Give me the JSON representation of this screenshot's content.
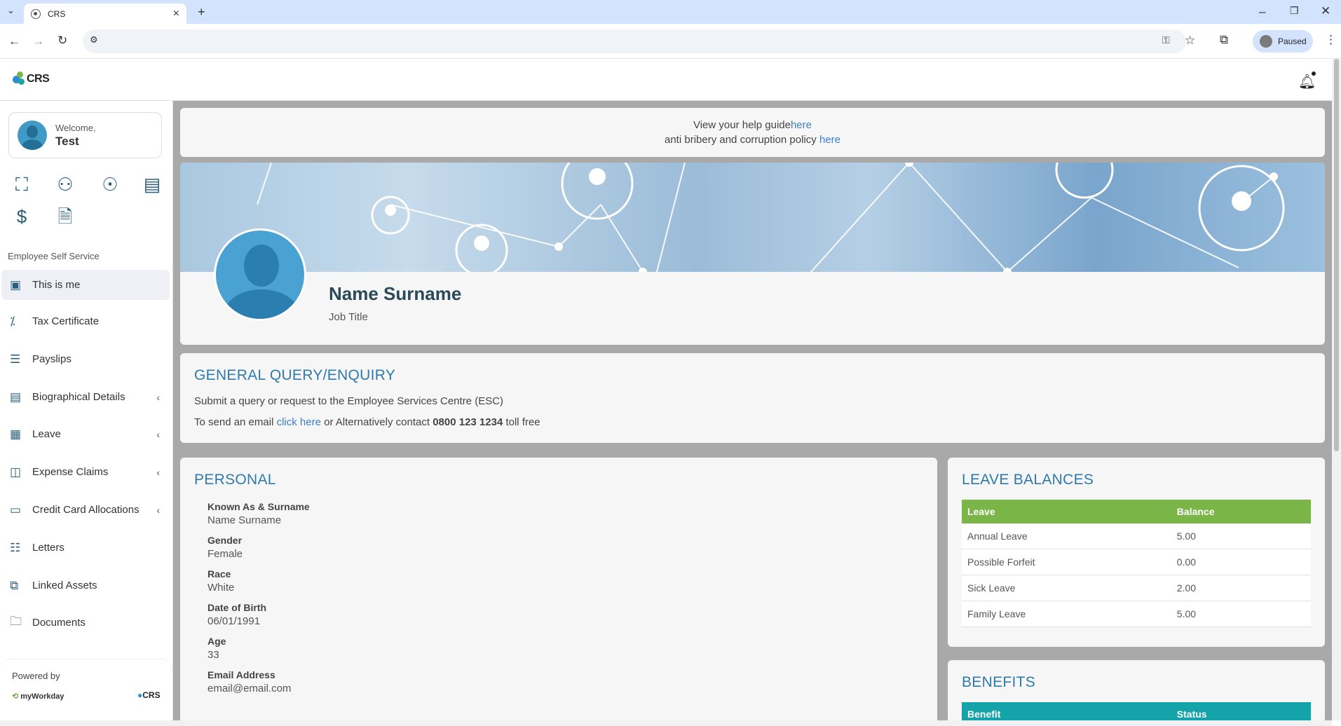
{
  "browser": {
    "tab_title": "CRS",
    "profile_status": "Paused"
  },
  "header": {
    "logo_text": "CRS"
  },
  "sidebar": {
    "welcome_label": "Welcome,",
    "user_name": "Test",
    "section_label": "Employee Self Service",
    "items": [
      {
        "label": "This is me",
        "icon": "user-square-icon",
        "active": true
      },
      {
        "label": "Tax Certificate",
        "icon": "tax-icon"
      },
      {
        "label": "Payslips",
        "icon": "payslip-icon"
      },
      {
        "label": "Biographical Details",
        "icon": "clipboard-icon",
        "expandable": true
      },
      {
        "label": "Leave",
        "icon": "calendar-icon",
        "expandable": true
      },
      {
        "label": "Expense Claims",
        "icon": "wallet-icon",
        "expandable": true
      },
      {
        "label": "Credit Card Allocations",
        "icon": "credit-card-icon",
        "expandable": true
      },
      {
        "label": "Letters",
        "icon": "letter-icon"
      },
      {
        "label": "Linked Assets",
        "icon": "link-asset-icon"
      },
      {
        "label": "Documents",
        "icon": "folder-icon"
      }
    ],
    "powered_by": "Powered by",
    "myworkday": "myWorkday",
    "crs_small": "CRS"
  },
  "help": {
    "line1_text": "View your help guide",
    "line1_link": "here",
    "line2_text": "anti bribery and corruption policy ",
    "line2_link": "here"
  },
  "profile": {
    "name": "Name Surname",
    "job_title": "Job Title"
  },
  "enquiry": {
    "title": "GENERAL QUERY/ENQUIRY",
    "line1": "Submit a query or request to the Employee Services Centre (ESC)",
    "line2_prefix": "To send an email ",
    "line2_link": "click here",
    "line2_middle": " or Alternatively contact ",
    "phone": "0800 123 1234",
    "line2_suffix": " toll free"
  },
  "personal": {
    "title": "PERSONAL",
    "fields": [
      {
        "label": "Known As & Surname",
        "value": "Name Surname"
      },
      {
        "label": "Gender",
        "value": "Female"
      },
      {
        "label": "Race",
        "value": "White"
      },
      {
        "label": "Date of Birth",
        "value": "06/01/1991"
      },
      {
        "label": "Age",
        "value": "33"
      },
      {
        "label": "Email Address",
        "value": "email@email.com"
      }
    ]
  },
  "leave_balances": {
    "title": "LEAVE BALANCES",
    "header_color": "#7ab547",
    "columns": [
      "Leave",
      "Balance"
    ],
    "rows": [
      [
        "Annual Leave",
        "5.00"
      ],
      [
        "Possible Forfeit",
        "0.00"
      ],
      [
        "Sick Leave",
        "2.00"
      ],
      [
        "Family Leave",
        "5.00"
      ]
    ]
  },
  "benefits": {
    "title": "BENEFITS",
    "header_color": "#14a3a8",
    "columns": [
      "Benefit",
      "Status"
    ]
  }
}
